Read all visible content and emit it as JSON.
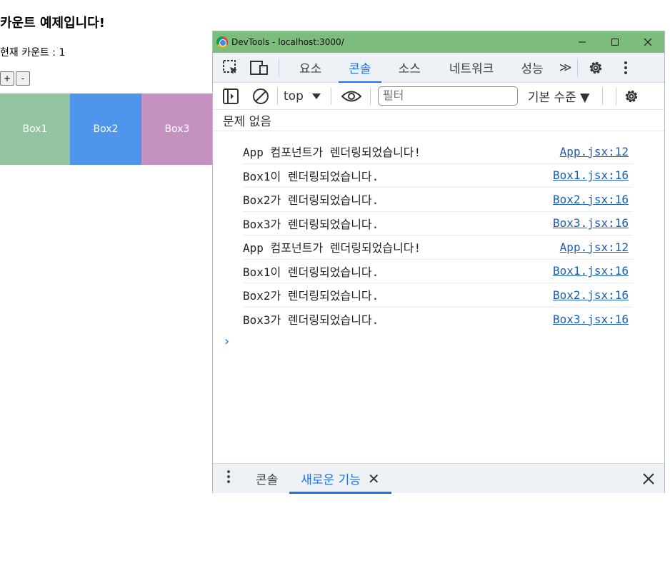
{
  "app": {
    "title": "카운트 예제입니다!",
    "count_text": "현재 카운트 : 1",
    "plus_label": "+",
    "minus_label": "-",
    "boxes": [
      "Box1",
      "Box2",
      "Box3"
    ],
    "box_colors": [
      "#94c49f",
      "#4f95ec",
      "#c491c0"
    ]
  },
  "devtools": {
    "window_title": "DevTools - localhost:3000/",
    "window_controls": {
      "minimize": "—",
      "maximize": "☐",
      "close": "✕"
    },
    "tabs": [
      "요소",
      "콘솔",
      "소스",
      "네트워크",
      "성능"
    ],
    "active_tab": "콘솔",
    "more_tabs": "≫",
    "context": "top",
    "filter_placeholder": "필터",
    "level": "기본 수준 ▼",
    "issues": "문제 없음",
    "logs": [
      {
        "message": "App 컴포넌트가 렌더링되었습니다!",
        "source": "App.jsx:12"
      },
      {
        "message": "Box1이 렌더링되었습니다.",
        "source": "Box1.jsx:16"
      },
      {
        "message": "Box2가 렌더링되었습니다.",
        "source": "Box2.jsx:16"
      },
      {
        "message": "Box3가 렌더링되었습니다.",
        "source": "Box3.jsx:16"
      },
      {
        "message": "App 컴포넌트가 렌더링되었습니다!",
        "source": "App.jsx:12"
      },
      {
        "message": "Box1이 렌더링되었습니다.",
        "source": "Box1.jsx:16"
      },
      {
        "message": "Box2가 렌더링되었습니다.",
        "source": "Box2.jsx:16"
      },
      {
        "message": "Box3가 렌더링되었습니다.",
        "source": "Box3.jsx:16"
      }
    ],
    "prompt": "›",
    "drawer": {
      "tabs": [
        "콘솔",
        "새로운 기능"
      ],
      "active_tab": "새로운 기능",
      "tab_close": "✕",
      "close": "✕"
    },
    "accent_color": "#1a73e8",
    "titlebar_color": "#7cbc7c"
  }
}
